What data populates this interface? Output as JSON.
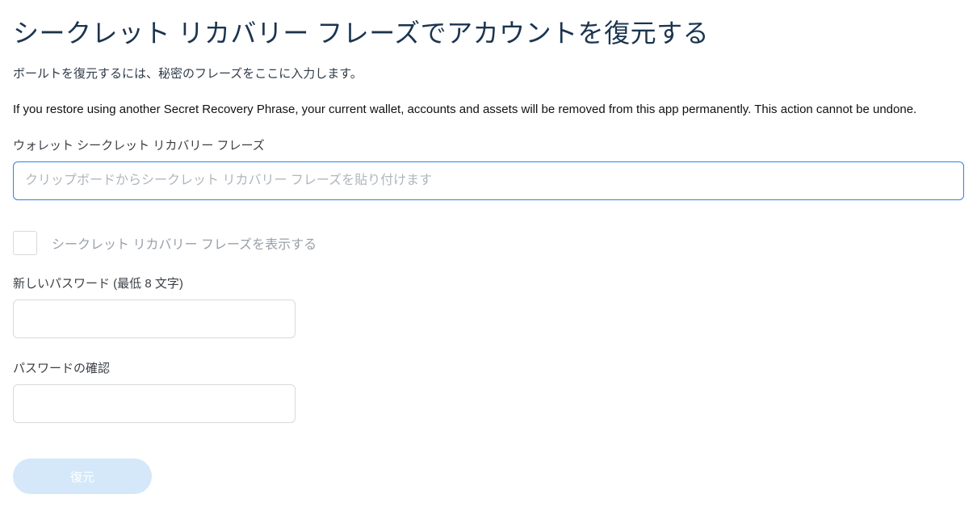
{
  "header": {
    "title": "シークレット リカバリー フレーズでアカウントを復元する",
    "subtitle": "ボールトを復元するには、秘密のフレーズをここに入力します。",
    "warning": "If you restore using another Secret Recovery Phrase, your current wallet, accounts and assets will be removed from this app permanently. This action cannot be undone."
  },
  "srp": {
    "label": "ウォレット シークレット リカバリー フレーズ",
    "placeholder": "クリップボードからシークレット リカバリー フレーズを貼り付けます",
    "value": ""
  },
  "show_srp": {
    "label": "シークレット リカバリー フレーズを表示する",
    "checked": false
  },
  "password": {
    "new_label": "新しいパスワード (最低 8 文字)",
    "new_value": "",
    "confirm_label": "パスワードの確認",
    "confirm_value": ""
  },
  "actions": {
    "restore_label": "復元"
  },
  "colors": {
    "title": "#1b344f",
    "input_focus_border": "#2f80ed",
    "button_bg_disabled": "#d4e8f9",
    "button_text": "#ffffff"
  }
}
